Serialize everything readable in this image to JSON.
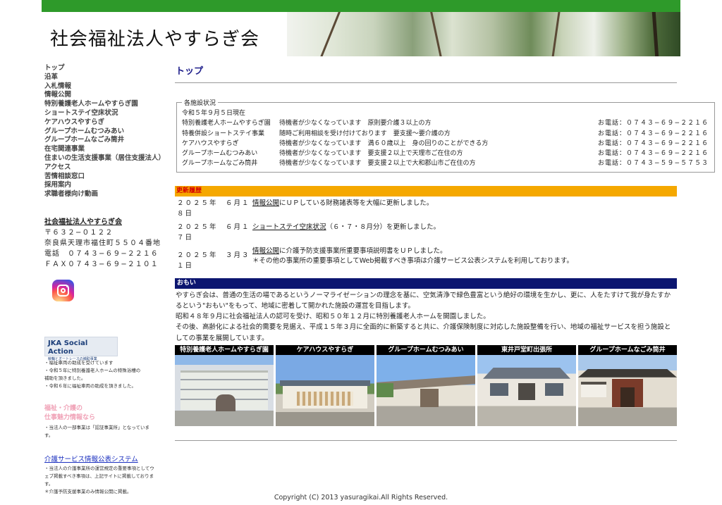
{
  "header": {
    "title": "社会福祉法人やすらぎ会"
  },
  "nav": [
    "トップ",
    "沿革",
    "入札情報",
    "情報公開",
    "特別養護老人ホームやすらぎ園",
    "ショートステイ空床状況",
    "ケアハウスやすらぎ",
    "グループホームむつみあい",
    "グループホームなごみ筒井",
    "在宅関連事業",
    "住まいの生活支援事業（居住支援法人）",
    "アクセス",
    "苦情相談窓口",
    "採用案内",
    "求職者様向け動画"
  ],
  "org": {
    "name": "社会福祉法人やすらぎ会",
    "zip": "〒６３２−０１２２",
    "address": "奈良県天理市福住町５５０４番地",
    "tel": "電話　０７４３−６９−２２１６",
    "fax": "ＦＡＸ０７４３−６９−２１０１"
  },
  "jka": {
    "title": "JKA Social Action",
    "subtitle": "競輪とオートレースの補助事業",
    "notes": [
      "・福祉車両の助成を受けています",
      "・令和５年に特別養護老人ホームの特殊浴槽の補助を頂きました。",
      "・令和６年に福祉車両の助成を頂きました。"
    ]
  },
  "recruit": {
    "line1": "福祉・介護の",
    "line2": "仕事魅力情報なら",
    "note": "・当法人の一部事業は「認証事業所」となっています。"
  },
  "kaigo": {
    "link": "介護サービス情報公表システム",
    "notes": [
      "・当法人の介護事業所の運営規定の重要事項としてウェブ掲載すべき事項は、上記サイトに掲載しております。",
      "＊介護予防支援事業のみ情報公開に掲載。"
    ]
  },
  "main": {
    "heading": "トップ",
    "facilities": {
      "legend": "各施設状況",
      "date": "令和５年９月５日現在",
      "rows": [
        {
          "name": "特別養護老人ホームやすらぎ園",
          "status": "待機者が少なくなっています　原則要介護３以上の方",
          "tel": "お電話：０７４３−６９−２２１６"
        },
        {
          "name": "特養併設ショートステイ事業",
          "status": "随時ご利用相談を受け付けております　要支援〜要介護の方",
          "tel": "お電話：０７４３−６９−２２１６"
        },
        {
          "name": "ケアハウスやすらぎ",
          "status": "待機者が少なくなっています　満６０歳以上　身の回りのことができる方",
          "tel": "お電話：０７４３−６９−２２１６"
        },
        {
          "name": "グループホームむつみあい",
          "status": "待機者が少なくなっています　要支援２以上で天理市ご在住の方",
          "tel": "お電話：０７４３−６９−２２１６"
        },
        {
          "name": "グループホームなごみ筒井",
          "status": "待機者が少なくなっています　要支援２以上で大和郡山市ご在住の方",
          "tel": "お電話：０７４３−５９−５７５３"
        }
      ]
    },
    "updates_title": "更新履歴",
    "updates": [
      {
        "date": "２０２５年　６月１８日",
        "link": "情報公開",
        "text": "にＵＰしている財務諸表等を大幅に更新しました。"
      },
      {
        "date": "２０２５年　６月１７日",
        "link": "ショートステイ空床状況",
        "text": "（６・７・８月分）を更新しました。"
      },
      {
        "date": "２０２５年　３月３１日",
        "link": "情報公開",
        "text": "に介護予防支援事業所重要事項説明書をＵＰしました。",
        "note": "＊その他の事業所の重要事項としてWeb掲載すべき事項は介護サービス公表システムを利用しております。"
      }
    ],
    "omoi_title": "おもい",
    "omoi": [
      "やすらぎ会は、普通の生活の場であるというノーマライゼーションの理念を基に、空気清浄で緑色豊富という絶好の環境を生かし、更に、人をたすけて我が身たすかるという\"おもい\"をもって、地域に密着して開かれた施設の運営を目指します。",
      "昭和４８年９月に社会福祉法人の認可を受け、昭和５０年１２月に特別養護老人ホームを開園しました。",
      "その後、高齢化による社会的需要を見据え、平成１５年３月に全面的に新築すると共に、介護保険制度に対応した施設整備を行い、地域の福祉サービスを担う施設としての事業を展開しています。"
    ],
    "photos": [
      "特別養護老人ホームやすらぎ園",
      "ケアハウスやすらぎ",
      "グループホームむつみあい",
      "東井戸堂町出張所",
      "グループホームなごみ筒井"
    ]
  },
  "footer": "Copyright (C) 2013 yasuragikai.All Rights Reserved.",
  "colors": {
    "topbar": "#2e9a2a",
    "updates_bar": "#f5a800",
    "omoi_bar": "#0c1670",
    "heading": "#1c1c8a"
  }
}
